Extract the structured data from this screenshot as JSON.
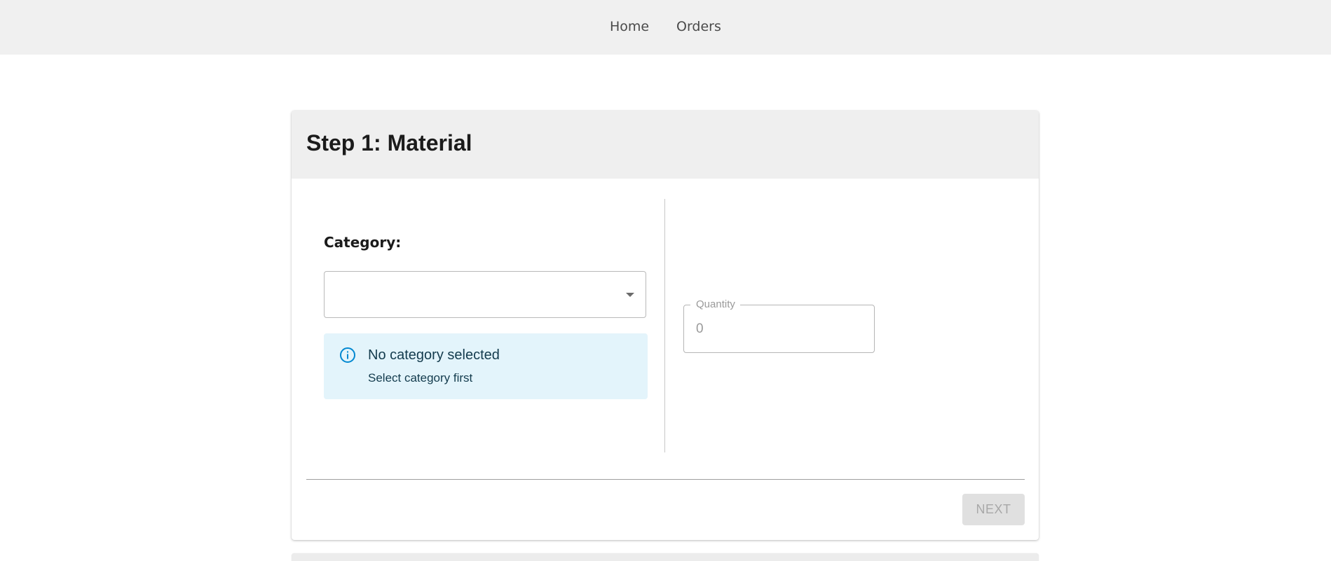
{
  "nav": {
    "home_label": "Home",
    "orders_label": "Orders"
  },
  "step": {
    "title": "Step 1: Material"
  },
  "category": {
    "label": "Category:",
    "selected_value": "",
    "icon": "chevron-down-icon"
  },
  "alert": {
    "icon": "info-icon",
    "title": "No category selected",
    "message": "Select category first",
    "color": "#0288d1",
    "background": "#e3f4fb"
  },
  "quantity": {
    "label": "Quantity",
    "value": "0"
  },
  "actions": {
    "next_label": "NEXT",
    "next_disabled": true
  }
}
